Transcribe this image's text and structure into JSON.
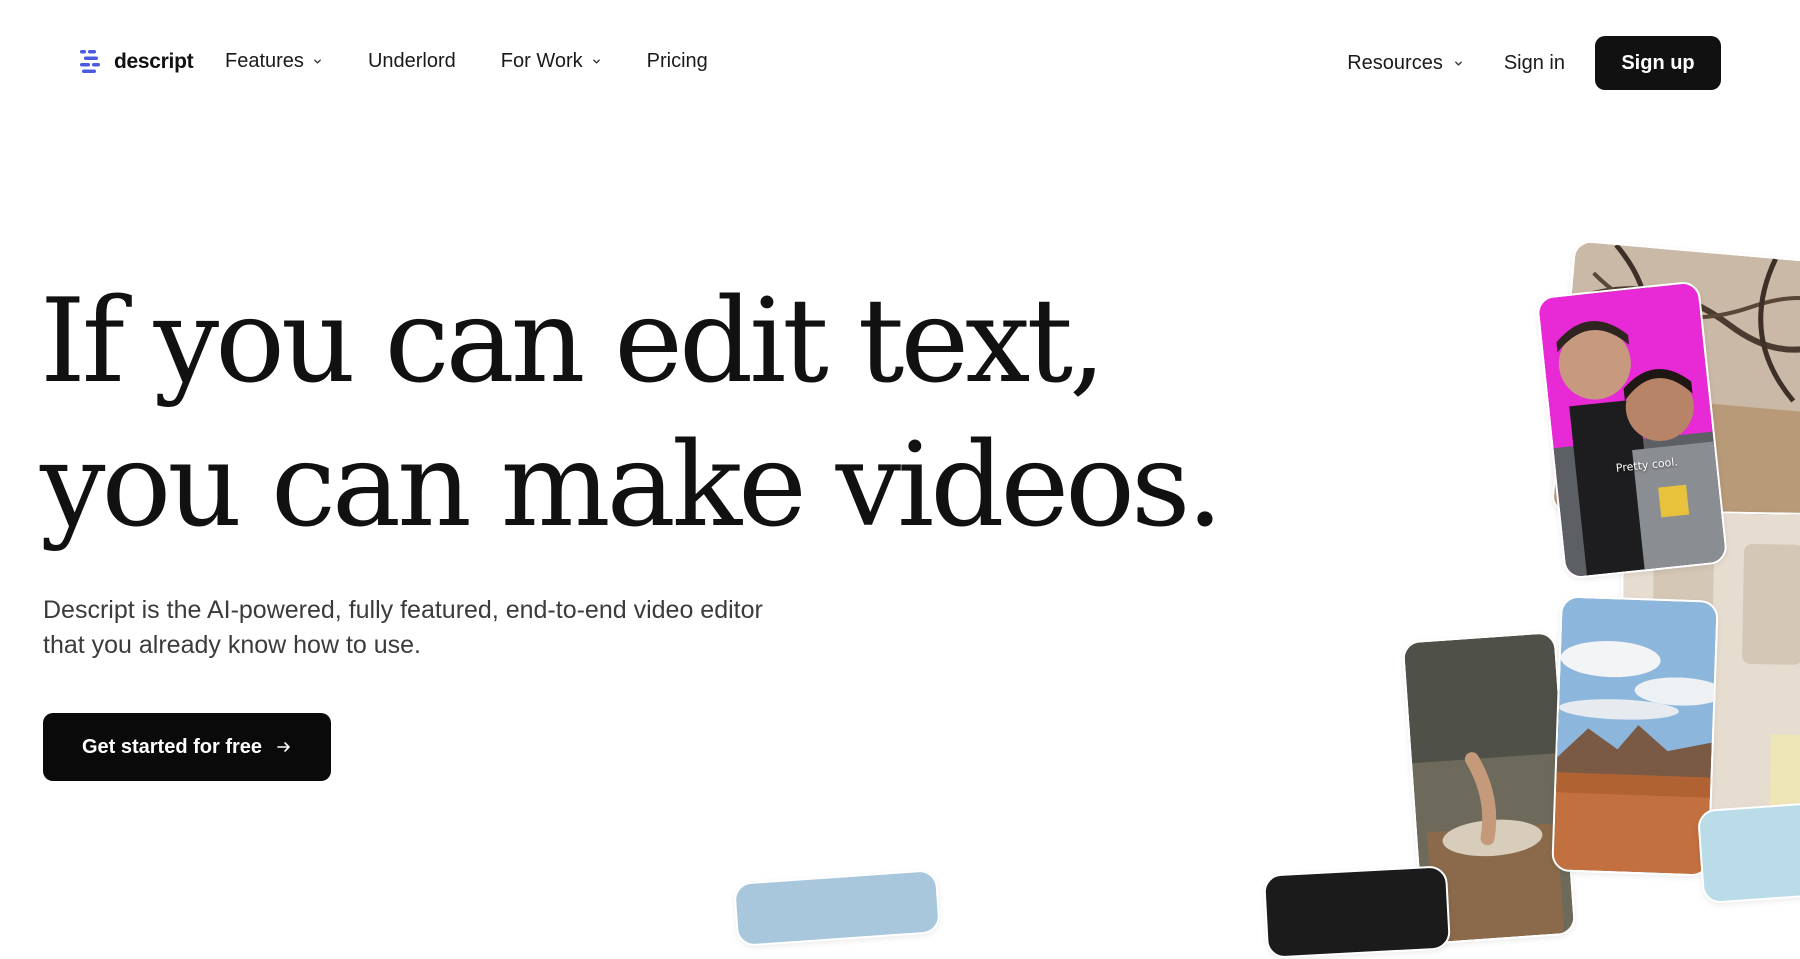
{
  "brand": {
    "name": "descript",
    "color": "#4a5be0"
  },
  "nav": {
    "items": [
      {
        "label": "Features",
        "dropdown": true
      },
      {
        "label": "Underlord",
        "dropdown": false
      },
      {
        "label": "For Work",
        "dropdown": true
      },
      {
        "label": "Pricing",
        "dropdown": false
      }
    ],
    "resources_label": "Resources",
    "sign_in_label": "Sign in",
    "sign_up_label": "Sign up"
  },
  "hero": {
    "headline_line1": "If you can edit text,",
    "headline_line2": "you can make videos.",
    "subtext": "Descript is the AI-powered, fully featured, end-to-end video editor that you already know how to use.",
    "cta_label": "Get started for free",
    "cta_icon": "arrow-right-icon"
  },
  "media": {
    "video_caption": "Pretty cool."
  },
  "colors": {
    "text": "#111111",
    "button_bg": "#111111",
    "button_text": "#ffffff",
    "subtext": "#3b3b3b"
  }
}
